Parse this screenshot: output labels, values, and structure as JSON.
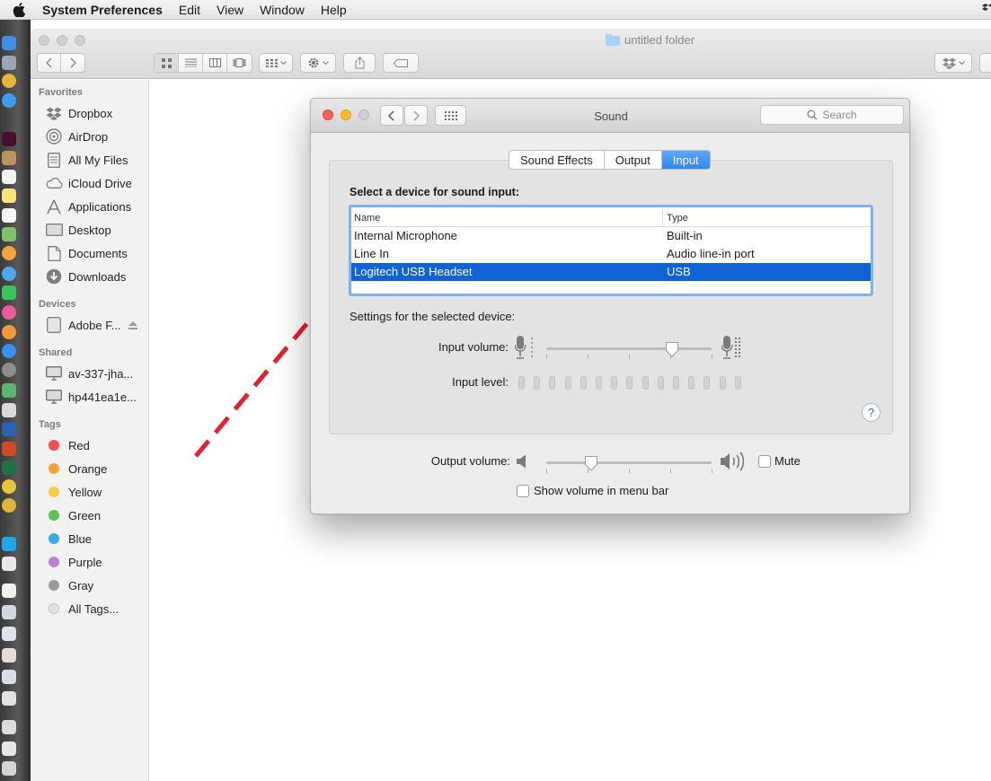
{
  "menubar": {
    "app_name": "System Preferences",
    "items": [
      "Edit",
      "View",
      "Window",
      "Help"
    ]
  },
  "finder": {
    "title": "untitled folder",
    "sidebar": {
      "favorites_heading": "Favorites",
      "favorites": [
        "Dropbox",
        "AirDrop",
        "All My Files",
        "iCloud Drive",
        "Applications",
        "Desktop",
        "Documents",
        "Downloads"
      ],
      "devices_heading": "Devices",
      "devices": [
        "Adobe F..."
      ],
      "shared_heading": "Shared",
      "shared": [
        "av-337-jha...",
        "hp441ea1e..."
      ],
      "tags_heading": "Tags",
      "tags": [
        {
          "label": "Red",
          "color": "#f2504e"
        },
        {
          "label": "Orange",
          "color": "#f7a13b"
        },
        {
          "label": "Yellow",
          "color": "#f6cf3f"
        },
        {
          "label": "Green",
          "color": "#5ec452"
        },
        {
          "label": "Blue",
          "color": "#3ba9ee"
        },
        {
          "label": "Purple",
          "color": "#c57ed8"
        },
        {
          "label": "Gray",
          "color": "#9b9b9b"
        },
        {
          "label": "All Tags...",
          "color": "#e0e0e0"
        }
      ]
    }
  },
  "sound": {
    "title": "Sound",
    "search_placeholder": "Search",
    "tabs": [
      {
        "label": "Sound Effects",
        "active": false
      },
      {
        "label": "Output",
        "active": false
      },
      {
        "label": "Input",
        "active": true
      }
    ],
    "select_heading": "Select a device for sound input:",
    "table": {
      "headers": [
        "Name",
        "Type"
      ],
      "rows": [
        {
          "name": "Internal Microphone",
          "type": "Built-in",
          "selected": false
        },
        {
          "name": "Line In",
          "type": "Audio line-in port",
          "selected": false
        },
        {
          "name": "Logitech USB Headset",
          "type": "USB",
          "selected": true
        }
      ]
    },
    "settings_label": "Settings for the selected device:",
    "input_volume_label": "Input volume:",
    "input_volume_level": 0.76,
    "input_level_label": "Input level:",
    "input_level_segments": 15,
    "input_level_value": 0,
    "help_label": "?",
    "output_volume_label": "Output volume:",
    "output_volume_level": 0.27,
    "mute_label": "Mute",
    "mute_checked": false,
    "show_volume_label": "Show volume in menu bar",
    "show_volume_checked": false
  },
  "annotation": {
    "color": "#e8202a"
  },
  "colors": {
    "accent": "#0f63d5",
    "tab_active": "#3a8ef0"
  }
}
